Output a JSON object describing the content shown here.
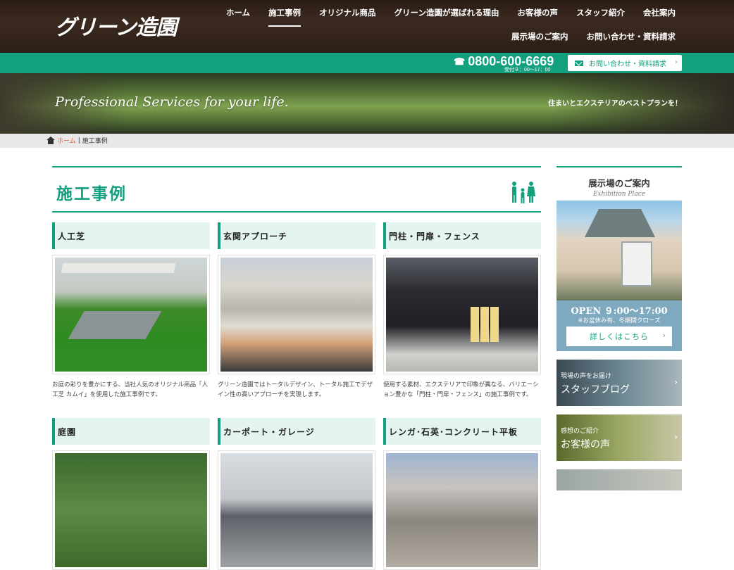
{
  "header": {
    "logo_text": "グリーン造園",
    "nav_row1": [
      "ホーム",
      "施工事例",
      "オリジナル商品",
      "グリーン造園が選ばれる理由",
      "お客様の声",
      "スタッフ紹介",
      "会社案内"
    ],
    "nav_row2": [
      "展示場のご案内",
      "お問い合わせ・資料請求"
    ],
    "active_nav": "施工事例",
    "phone": "0800-600-6669",
    "phone_hours": "受付９：00〜17：00",
    "contact_label": "お問い合わせ・資料請求"
  },
  "hero": {
    "tagline": "Professional Services for your life.",
    "subtext": "住まいとエクステリアのベストプランを！"
  },
  "breadcrumb": {
    "home": "ホーム",
    "current": "施工事例"
  },
  "main": {
    "title": "施工事例",
    "cards": [
      {
        "category": "人工芝",
        "description": "お庭の彩りを豊かにする、当社人気のオリジナル商品「人工芝 カムイ」を使用した施工事例です。",
        "image": "turf"
      },
      {
        "category": "玄関アプローチ",
        "description": "グリーン造園ではトータルデザイン、トータル施工でデザイン性の高いアプローチを実現します。",
        "image": "approach"
      },
      {
        "category": "門柱・門扉・フェンス",
        "description": "使用する素材、エクステリアで印象が異なる、バリエーション豊かな「門柱・門扉・フェンス」の施工事例です。",
        "image": "gate"
      },
      {
        "category": "庭園",
        "description": "",
        "image": "garden"
      },
      {
        "category": "カーポート・ガレージ",
        "description": "",
        "image": "carport"
      },
      {
        "category": "レンガ･石英･コンクリート平板",
        "description": "",
        "image": "brick"
      }
    ]
  },
  "sidebar": {
    "showroom_title": "展示場のご案内",
    "showroom_sub": "Exhibition Place",
    "open_hours": "OPEN ９:00〜17:00",
    "open_note": "※お盆休み有、冬期間クローズ",
    "detail_label": "詳しくはこちら",
    "banners": [
      {
        "small": "現場の声をお届け",
        "big": "スタッフブログ"
      },
      {
        "small": "感想のご紹介",
        "big": "お客様の声"
      }
    ]
  },
  "colors": {
    "accent": "#12a07f",
    "header_bg": "#2c1e16",
    "category_bg": "#e4f4f1",
    "breadcrumb_link": "#e05a28"
  }
}
